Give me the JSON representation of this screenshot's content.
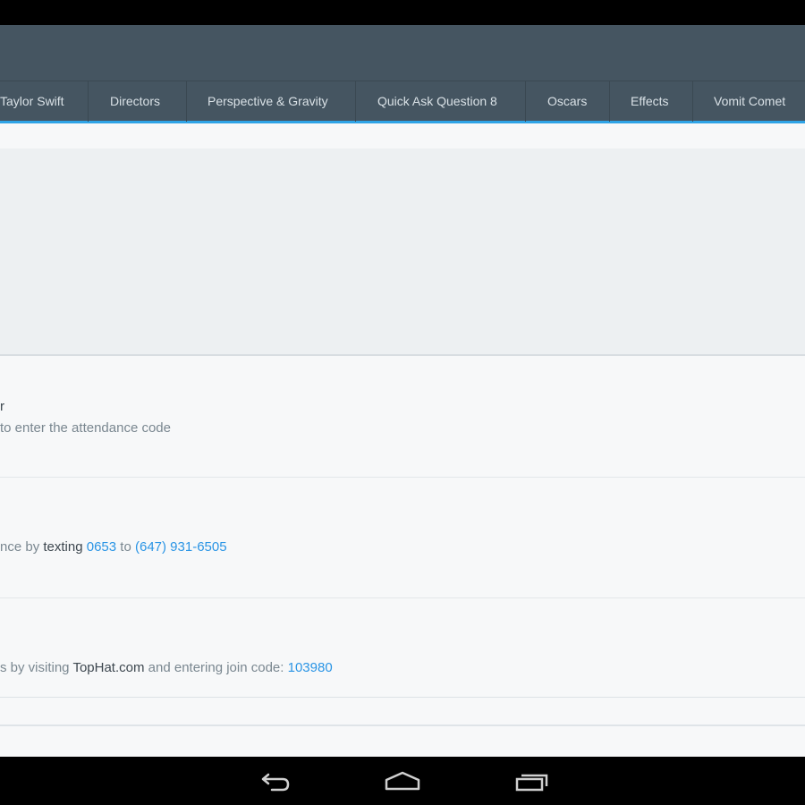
{
  "tabs": [
    {
      "label": "Taylor Swift"
    },
    {
      "label": "Directors"
    },
    {
      "label": "Perspective & Gravity"
    },
    {
      "label": "Quick Ask Question 8"
    },
    {
      "label": "Oscars"
    },
    {
      "label": "Effects"
    },
    {
      "label": "Vomit Comet"
    }
  ],
  "attendance": {
    "title_fragment": "r",
    "instruction": "to enter the attendance code"
  },
  "texting": {
    "prefix": "nce by ",
    "verb": "texting",
    "code": "0653",
    "to": " to ",
    "phone": "(647) 931-6505"
  },
  "join": {
    "prefix": "s by visiting ",
    "site": "TopHat.com",
    "middle": " and entering join code: ",
    "code": "103980"
  },
  "navigation": {
    "back": "back-icon",
    "home": "home-icon",
    "recents": "recent-apps-icon"
  },
  "colors": {
    "header": "#455561",
    "accent": "#2fa4e7",
    "link": "#2b95e5"
  }
}
